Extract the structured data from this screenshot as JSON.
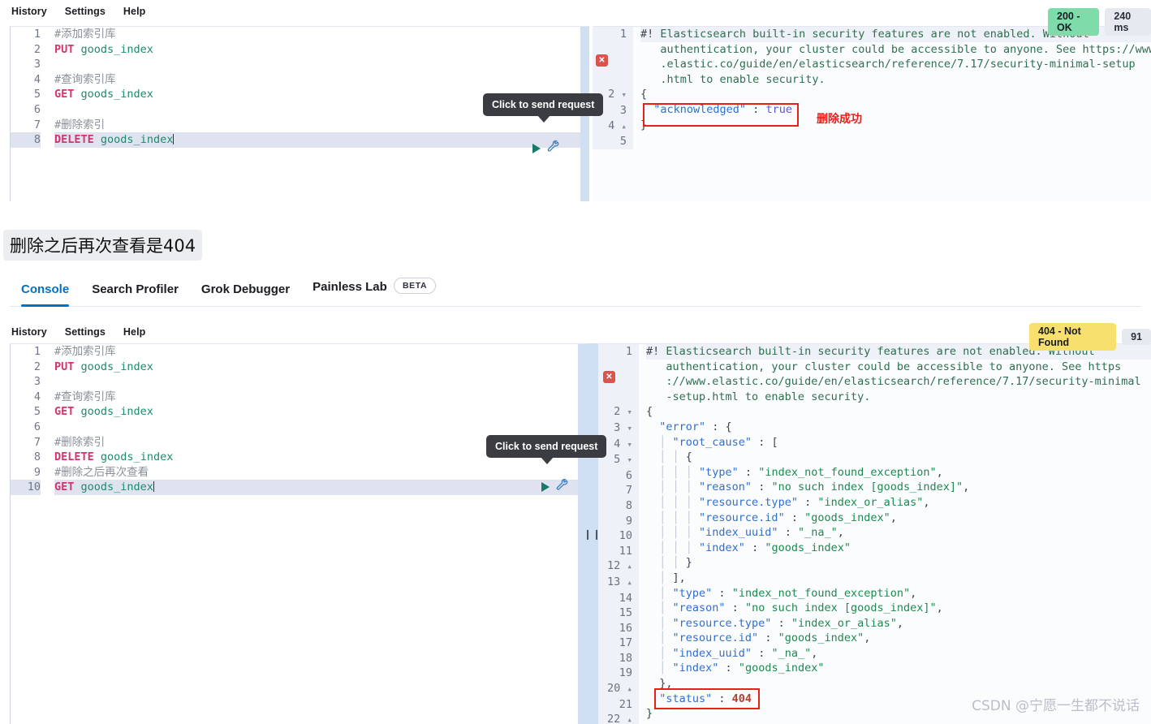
{
  "menu": {
    "items": [
      "History",
      "Settings",
      "Help"
    ]
  },
  "tabs": [
    {
      "label": "Console",
      "active": true
    },
    {
      "label": "Search Profiler",
      "active": false
    },
    {
      "label": "Grok Debugger",
      "active": false
    },
    {
      "label": "Painless Lab",
      "active": false,
      "pill": "BETA"
    }
  ],
  "caption": "删除之后再次查看是404",
  "watermark": "CSDN @宁愿一生都不说话",
  "tooltip": {
    "text": "Click to send request"
  },
  "icons": {
    "play": "play-icon",
    "wrench": "wrench-icon",
    "error_marker": "error-marker-icon",
    "resizer": "resize-handle-icon"
  },
  "panel_top": {
    "status": {
      "code": "200 - OK",
      "time": "240 ms",
      "color": "#7ddcaa"
    },
    "editor_lines": [
      {
        "n": 1,
        "type": "comment",
        "text": "#添加索引库"
      },
      {
        "n": 2,
        "type": "request",
        "method": "PUT",
        "path": "goods_index"
      },
      {
        "n": 3,
        "type": "blank",
        "text": ""
      },
      {
        "n": 4,
        "type": "comment",
        "text": "#查询索引库"
      },
      {
        "n": 5,
        "type": "request",
        "method": "GET",
        "path": "goods_index"
      },
      {
        "n": 6,
        "type": "blank",
        "text": ""
      },
      {
        "n": 7,
        "type": "comment",
        "text": "#删除索引"
      },
      {
        "n": 8,
        "type": "request",
        "method": "DELETE",
        "path": "goods_index",
        "active": true
      }
    ],
    "output_lines": [
      {
        "n": 1,
        "fold": "",
        "segments": [
          {
            "c": "warnhead",
            "t": "#! "
          },
          {
            "c": "warn",
            "t": "Elasticsearch built-in security features are not enabled. Without"
          }
        ]
      },
      {
        "n": "",
        "fold": "",
        "segments": [
          {
            "c": "warn",
            "t": "   authentication, your cluster could be accessible to anyone. See https://www"
          }
        ]
      },
      {
        "n": "",
        "fold": "",
        "segments": [
          {
            "c": "warn",
            "t": "   .elastic.co/guide/en/elasticsearch/reference/7.17/security-minimal-setup"
          }
        ]
      },
      {
        "n": "",
        "fold": "",
        "segments": [
          {
            "c": "warn",
            "t": "   .html to enable security."
          }
        ]
      },
      {
        "n": 2,
        "fold": "▾",
        "segments": [
          {
            "c": "punc",
            "t": "{"
          }
        ]
      },
      {
        "n": 3,
        "fold": "",
        "segments": [
          {
            "c": "key",
            "t": "  \"acknowledged\""
          },
          {
            "c": "punc",
            "t": " : "
          },
          {
            "c": "bool",
            "t": "true"
          }
        ]
      },
      {
        "n": 4,
        "fold": "▴",
        "segments": [
          {
            "c": "punc",
            "t": "}"
          }
        ]
      },
      {
        "n": 5,
        "fold": "",
        "segments": [
          {
            "c": "punc",
            "t": ""
          }
        ]
      }
    ],
    "annotation": {
      "text": "删除成功",
      "color": "#e8201a"
    }
  },
  "panel_bottom": {
    "status": {
      "code": "404 - Not Found",
      "time": "91",
      "color": "#f7e06e"
    },
    "editor_lines": [
      {
        "n": 1,
        "type": "comment",
        "text": "#添加索引库"
      },
      {
        "n": 2,
        "type": "request",
        "method": "PUT",
        "path": "goods_index"
      },
      {
        "n": 3,
        "type": "blank",
        "text": ""
      },
      {
        "n": 4,
        "type": "comment",
        "text": "#查询索引库"
      },
      {
        "n": 5,
        "type": "request",
        "method": "GET",
        "path": "goods_index"
      },
      {
        "n": 6,
        "type": "blank",
        "text": ""
      },
      {
        "n": 7,
        "type": "comment",
        "text": "#删除索引"
      },
      {
        "n": 8,
        "type": "request",
        "method": "DELETE",
        "path": "goods_index"
      },
      {
        "n": 9,
        "type": "comment",
        "text": "#删除之后再次查看"
      },
      {
        "n": 10,
        "type": "request",
        "method": "GET",
        "path": "goods_index",
        "active": true
      }
    ],
    "output_lines": [
      {
        "n": 1,
        "fold": "",
        "segments": [
          {
            "c": "warnhead",
            "t": "#! "
          },
          {
            "c": "warn",
            "t": "Elasticsearch built-in security features are not enabled. Without"
          }
        ]
      },
      {
        "n": "",
        "fold": "",
        "segments": [
          {
            "c": "warn",
            "t": "   authentication, your cluster could be accessible to anyone. See https"
          }
        ]
      },
      {
        "n": "",
        "fold": "",
        "segments": [
          {
            "c": "warn",
            "t": "   ://www.elastic.co/guide/en/elasticsearch/reference/7.17/security-minimal"
          }
        ]
      },
      {
        "n": "",
        "fold": "",
        "segments": [
          {
            "c": "warn",
            "t": "   -setup.html to enable security."
          }
        ]
      },
      {
        "n": 2,
        "fold": "▾",
        "segments": [
          {
            "c": "punc",
            "t": "{"
          }
        ]
      },
      {
        "n": 3,
        "fold": "▾",
        "segments": [
          {
            "c": "key",
            "t": "  \"error\""
          },
          {
            "c": "punc",
            "t": " : {"
          }
        ]
      },
      {
        "n": 4,
        "fold": "▾",
        "segments": [
          {
            "c": "pipe",
            "t": "  │ "
          },
          {
            "c": "key",
            "t": "\"root_cause\""
          },
          {
            "c": "punc",
            "t": " : ["
          }
        ]
      },
      {
        "n": 5,
        "fold": "▾",
        "segments": [
          {
            "c": "pipe",
            "t": "  │ │ "
          },
          {
            "c": "punc",
            "t": "{"
          }
        ]
      },
      {
        "n": 6,
        "fold": "",
        "segments": [
          {
            "c": "pipe",
            "t": "  │ │ │ "
          },
          {
            "c": "key",
            "t": "\"type\""
          },
          {
            "c": "punc",
            "t": " : "
          },
          {
            "c": "str",
            "t": "\"index_not_found_exception\""
          },
          {
            "c": "punc",
            "t": ","
          }
        ]
      },
      {
        "n": 7,
        "fold": "",
        "segments": [
          {
            "c": "pipe",
            "t": "  │ │ │ "
          },
          {
            "c": "key",
            "t": "\"reason\""
          },
          {
            "c": "punc",
            "t": " : "
          },
          {
            "c": "str",
            "t": "\"no such index [goods_index]\""
          },
          {
            "c": "punc",
            "t": ","
          }
        ]
      },
      {
        "n": 8,
        "fold": "",
        "segments": [
          {
            "c": "pipe",
            "t": "  │ │ │ "
          },
          {
            "c": "key",
            "t": "\"resource.type\""
          },
          {
            "c": "punc",
            "t": " : "
          },
          {
            "c": "str",
            "t": "\"index_or_alias\""
          },
          {
            "c": "punc",
            "t": ","
          }
        ]
      },
      {
        "n": 9,
        "fold": "",
        "segments": [
          {
            "c": "pipe",
            "t": "  │ │ │ "
          },
          {
            "c": "key",
            "t": "\"resource.id\""
          },
          {
            "c": "punc",
            "t": " : "
          },
          {
            "c": "str",
            "t": "\"goods_index\""
          },
          {
            "c": "punc",
            "t": ","
          }
        ]
      },
      {
        "n": 10,
        "fold": "",
        "segments": [
          {
            "c": "pipe",
            "t": "  │ │ │ "
          },
          {
            "c": "key",
            "t": "\"index_uuid\""
          },
          {
            "c": "punc",
            "t": " : "
          },
          {
            "c": "str",
            "t": "\"_na_\""
          },
          {
            "c": "punc",
            "t": ","
          }
        ]
      },
      {
        "n": 11,
        "fold": "",
        "segments": [
          {
            "c": "pipe",
            "t": "  │ │ │ "
          },
          {
            "c": "key",
            "t": "\"index\""
          },
          {
            "c": "punc",
            "t": " : "
          },
          {
            "c": "str",
            "t": "\"goods_index\""
          }
        ]
      },
      {
        "n": 12,
        "fold": "▴",
        "segments": [
          {
            "c": "pipe",
            "t": "  │ │ "
          },
          {
            "c": "punc",
            "t": "}"
          }
        ]
      },
      {
        "n": 13,
        "fold": "▴",
        "segments": [
          {
            "c": "pipe",
            "t": "  │ "
          },
          {
            "c": "punc",
            "t": "],"
          }
        ]
      },
      {
        "n": 14,
        "fold": "",
        "segments": [
          {
            "c": "pipe",
            "t": "  │ "
          },
          {
            "c": "key",
            "t": "\"type\""
          },
          {
            "c": "punc",
            "t": " : "
          },
          {
            "c": "str",
            "t": "\"index_not_found_exception\""
          },
          {
            "c": "punc",
            "t": ","
          }
        ]
      },
      {
        "n": 15,
        "fold": "",
        "segments": [
          {
            "c": "pipe",
            "t": "  │ "
          },
          {
            "c": "key",
            "t": "\"reason\""
          },
          {
            "c": "punc",
            "t": " : "
          },
          {
            "c": "str",
            "t": "\"no such index [goods_index]\""
          },
          {
            "c": "punc",
            "t": ","
          }
        ]
      },
      {
        "n": 16,
        "fold": "",
        "segments": [
          {
            "c": "pipe",
            "t": "  │ "
          },
          {
            "c": "key",
            "t": "\"resource.type\""
          },
          {
            "c": "punc",
            "t": " : "
          },
          {
            "c": "str",
            "t": "\"index_or_alias\""
          },
          {
            "c": "punc",
            "t": ","
          }
        ]
      },
      {
        "n": 17,
        "fold": "",
        "segments": [
          {
            "c": "pipe",
            "t": "  │ "
          },
          {
            "c": "key",
            "t": "\"resource.id\""
          },
          {
            "c": "punc",
            "t": " : "
          },
          {
            "c": "str",
            "t": "\"goods_index\""
          },
          {
            "c": "punc",
            "t": ","
          }
        ]
      },
      {
        "n": 18,
        "fold": "",
        "segments": [
          {
            "c": "pipe",
            "t": "  │ "
          },
          {
            "c": "key",
            "t": "\"index_uuid\""
          },
          {
            "c": "punc",
            "t": " : "
          },
          {
            "c": "str",
            "t": "\"_na_\""
          },
          {
            "c": "punc",
            "t": ","
          }
        ]
      },
      {
        "n": 19,
        "fold": "",
        "segments": [
          {
            "c": "pipe",
            "t": "  │ "
          },
          {
            "c": "key",
            "t": "\"index\""
          },
          {
            "c": "punc",
            "t": " : "
          },
          {
            "c": "str",
            "t": "\"goods_index\""
          }
        ]
      },
      {
        "n": 20,
        "fold": "▴",
        "segments": [
          {
            "c": "punc",
            "t": "  },"
          }
        ]
      },
      {
        "n": 21,
        "fold": "",
        "segments": [
          {
            "c": "key",
            "t": "  \"status\""
          },
          {
            "c": "punc",
            "t": " : "
          },
          {
            "c": "num",
            "t": "404"
          }
        ]
      },
      {
        "n": 22,
        "fold": "▴",
        "segments": [
          {
            "c": "punc",
            "t": "}"
          }
        ]
      }
    ]
  }
}
